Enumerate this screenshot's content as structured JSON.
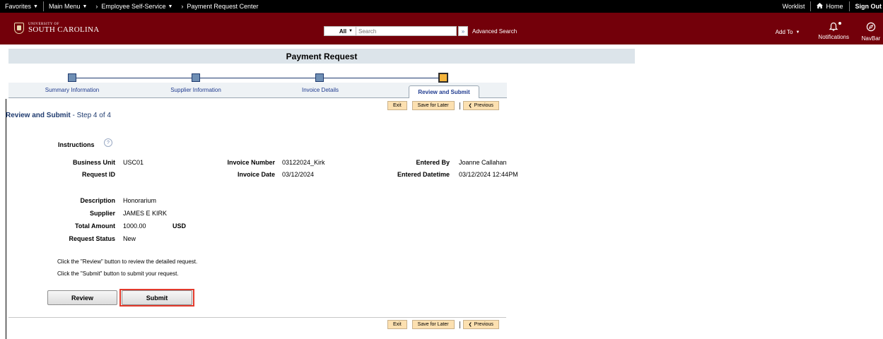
{
  "topbar": {
    "favorites": "Favorites",
    "main_menu": "Main Menu",
    "breadcrumb_1": "Employee Self-Service",
    "breadcrumb_2": "Payment Request Center",
    "worklist": "Worklist",
    "home": "Home",
    "sign_out": "Sign Out"
  },
  "header": {
    "logo_small": "UNIVERSITY OF",
    "logo_big": "SOUTH CAROLINA",
    "search_scope": "All",
    "search_placeholder": "Search",
    "advanced_search": "Advanced Search",
    "add_to": "Add To",
    "notifications": "Notifications",
    "navbar": "NavBar"
  },
  "page": {
    "title": "Payment Request"
  },
  "train": {
    "steps": [
      {
        "label": "Summary Information"
      },
      {
        "label": "Supplier Information"
      },
      {
        "label": "Invoice Details"
      },
      {
        "label": "Review and Submit"
      }
    ]
  },
  "actions": {
    "exit": "Exit",
    "save_for_later": "Save for Later",
    "previous": "Previous"
  },
  "step_heading": {
    "title": "Review and Submit",
    "suffix": " - Step 4 of 4"
  },
  "form": {
    "instructions_label": "Instructions",
    "business_unit_label": "Business Unit",
    "business_unit": "USC01",
    "request_id_label": "Request ID",
    "request_id": "",
    "invoice_number_label": "Invoice Number",
    "invoice_number": "03122024_Kirk",
    "invoice_date_label": "Invoice Date",
    "invoice_date": "03/12/2024",
    "entered_by_label": "Entered By",
    "entered_by": "Joanne Callahan",
    "entered_datetime_label": "Entered Datetime",
    "entered_datetime": "03/12/2024 12:44PM",
    "description_label": "Description",
    "description": "Honorarium",
    "supplier_label": "Supplier",
    "supplier": "JAMES E KIRK",
    "total_amount_label": "Total Amount",
    "total_amount": "1000.00",
    "currency": "USD",
    "request_status_label": "Request Status",
    "request_status": "New"
  },
  "notes": {
    "review_note": "Click the \"Review\" button to review the detailed request.",
    "submit_note": "Click the \"Submit\" button to submit your request."
  },
  "buttons": {
    "review": "Review",
    "submit": "Submit"
  },
  "colors": {
    "header_maroon": "#73000a",
    "accent_blue": "#1f3b6f",
    "highlight_red": "#e23a2c",
    "step_active": "#f4b43c"
  }
}
